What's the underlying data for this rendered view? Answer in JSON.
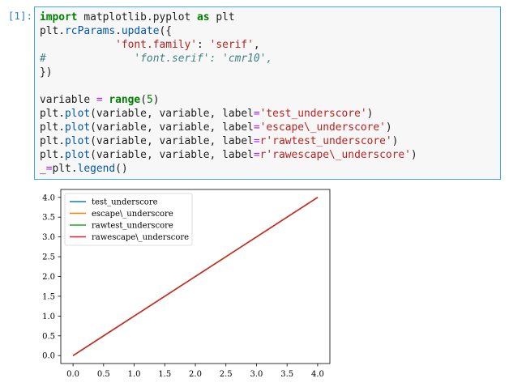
{
  "notebook": {
    "prompt": "[1]:",
    "code_lines": [
      [
        {
          "t": "import",
          "c": "kw"
        },
        {
          "t": " matplotlib.pyplot "
        },
        {
          "t": "as",
          "c": "kw"
        },
        {
          "t": " plt"
        }
      ],
      [
        {
          "t": "plt."
        },
        {
          "t": "rcParams",
          "c": "fn"
        },
        {
          "t": "."
        },
        {
          "t": "update",
          "c": "fn"
        },
        {
          "t": "({"
        }
      ],
      [
        {
          "t": "            "
        },
        {
          "t": "'font.family'",
          "c": "str"
        },
        {
          "t": ": "
        },
        {
          "t": "'serif'",
          "c": "str"
        },
        {
          "t": ","
        }
      ],
      [
        {
          "t": "#              'font.serif': 'cmr10',",
          "c": "cm"
        }
      ],
      [
        {
          "t": "})"
        }
      ],
      [
        {
          "t": ""
        }
      ],
      [
        {
          "t": "variable "
        },
        {
          "t": "=",
          "c": "op"
        },
        {
          "t": " "
        },
        {
          "t": "range",
          "c": "kw"
        },
        {
          "t": "("
        },
        {
          "t": "5",
          "c": "num"
        },
        {
          "t": ")"
        }
      ],
      [
        {
          "t": "plt."
        },
        {
          "t": "plot",
          "c": "fn"
        },
        {
          "t": "(variable, variable, label"
        },
        {
          "t": "=",
          "c": "op"
        },
        {
          "t": "'test_underscore'",
          "c": "str"
        },
        {
          "t": ")"
        }
      ],
      [
        {
          "t": "plt."
        },
        {
          "t": "plot",
          "c": "fn"
        },
        {
          "t": "(variable, variable, label"
        },
        {
          "t": "=",
          "c": "op"
        },
        {
          "t": "'escape\\_underscore'",
          "c": "str"
        },
        {
          "t": ")"
        }
      ],
      [
        {
          "t": "plt."
        },
        {
          "t": "plot",
          "c": "fn"
        },
        {
          "t": "(variable, variable, label"
        },
        {
          "t": "=",
          "c": "op"
        },
        {
          "t": "r'rawtest_underscore'",
          "c": "str"
        },
        {
          "t": ")"
        }
      ],
      [
        {
          "t": "plt."
        },
        {
          "t": "plot",
          "c": "fn"
        },
        {
          "t": "(variable, variable, label"
        },
        {
          "t": "=",
          "c": "op"
        },
        {
          "t": "r'rawescape\\_underscore'",
          "c": "str"
        },
        {
          "t": ")"
        }
      ],
      [
        {
          "t": "_"
        },
        {
          "t": "=",
          "c": "op"
        },
        {
          "t": "plt."
        },
        {
          "t": "legend",
          "c": "fn"
        },
        {
          "t": "()"
        }
      ]
    ]
  },
  "chart_data": {
    "type": "line",
    "title": "",
    "xlabel": "",
    "ylabel": "",
    "xlim": [
      -0.2,
      4.2
    ],
    "ylim": [
      -0.2,
      4.2
    ],
    "xticks": [
      "0.0",
      "0.5",
      "1.0",
      "1.5",
      "2.0",
      "2.5",
      "3.0",
      "3.5",
      "4.0"
    ],
    "yticks": [
      "0.0",
      "0.5",
      "1.0",
      "1.5",
      "2.0",
      "2.5",
      "3.0",
      "3.5",
      "4.0"
    ],
    "grid": false,
    "legend_position": "top-left",
    "series": [
      {
        "name": "test_underscore",
        "color": "#1f77b4",
        "x": [
          0,
          1,
          2,
          3,
          4
        ],
        "y": [
          0,
          1,
          2,
          3,
          4
        ]
      },
      {
        "name": "escape\\_underscore",
        "color": "#ff7f0e",
        "x": [
          0,
          1,
          2,
          3,
          4
        ],
        "y": [
          0,
          1,
          2,
          3,
          4
        ]
      },
      {
        "name": "rawtest_underscore",
        "color": "#2ca02c",
        "x": [
          0,
          1,
          2,
          3,
          4
        ],
        "y": [
          0,
          1,
          2,
          3,
          4
        ]
      },
      {
        "name": "rawescape\\_underscore",
        "color": "#d62728",
        "x": [
          0,
          1,
          2,
          3,
          4
        ],
        "y": [
          0,
          1,
          2,
          3,
          4
        ]
      }
    ]
  }
}
